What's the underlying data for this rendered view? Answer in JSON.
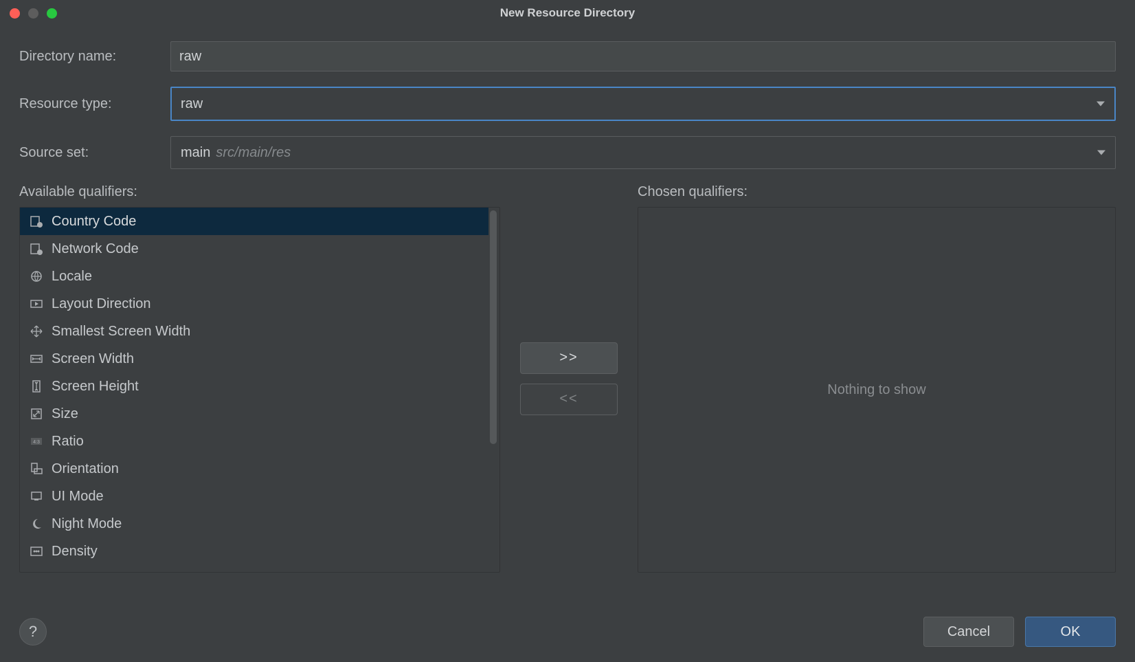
{
  "title": "New Resource Directory",
  "fields": {
    "directory_label": "Directory name:",
    "directory_value": "raw",
    "resource_type_label": "Resource type:",
    "resource_type_value": "raw",
    "source_set_label": "Source set:",
    "source_set_value": "main",
    "source_set_secondary": "src/main/res"
  },
  "available_label": "Available qualifiers:",
  "chosen_label": "Chosen qualifiers:",
  "qualifiers": [
    {
      "label": "Country Code",
      "icon": "country-code-icon",
      "selected": true
    },
    {
      "label": "Network Code",
      "icon": "network-code-icon"
    },
    {
      "label": "Locale",
      "icon": "locale-icon"
    },
    {
      "label": "Layout Direction",
      "icon": "layout-direction-icon"
    },
    {
      "label": "Smallest Screen Width",
      "icon": "smallest-width-icon"
    },
    {
      "label": "Screen Width",
      "icon": "screen-width-icon"
    },
    {
      "label": "Screen Height",
      "icon": "screen-height-icon"
    },
    {
      "label": "Size",
      "icon": "size-icon"
    },
    {
      "label": "Ratio",
      "icon": "ratio-icon"
    },
    {
      "label": "Orientation",
      "icon": "orientation-icon"
    },
    {
      "label": "UI Mode",
      "icon": "ui-mode-icon"
    },
    {
      "label": "Night Mode",
      "icon": "night-mode-icon"
    },
    {
      "label": "Density",
      "icon": "density-icon"
    }
  ],
  "move_add_label": ">>",
  "move_remove_label": "<<",
  "empty_text": "Nothing to show",
  "help_label": "?",
  "cancel_label": "Cancel",
  "ok_label": "OK"
}
